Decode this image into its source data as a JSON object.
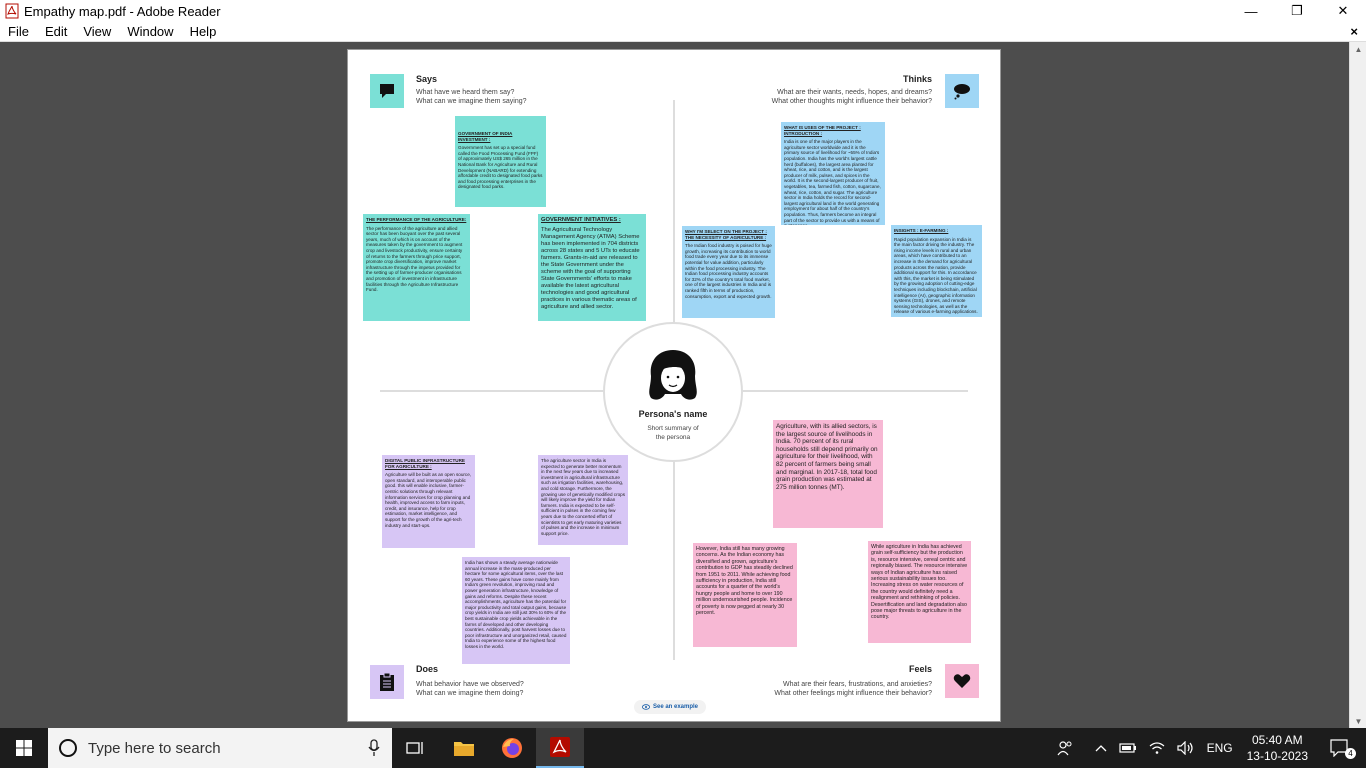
{
  "window": {
    "title": "Empathy map.pdf - Adobe Reader",
    "minimize": "—",
    "maximize": "❐",
    "close": "✕"
  },
  "menu": {
    "items": [
      "File",
      "Edit",
      "View",
      "Window",
      "Help"
    ],
    "close": "×"
  },
  "map": {
    "says": {
      "title": "Says",
      "line1": "What have we heard them say?",
      "line2": "What can we imagine them saying?"
    },
    "thinks": {
      "title": "Thinks",
      "line1": "What are their wants, needs, hopes, and dreams?",
      "line2": "What other thoughts might influence their behavior?"
    },
    "does": {
      "title": "Does",
      "line1": "What behavior have we observed?",
      "line2": "What can we imagine them doing?"
    },
    "feels": {
      "title": "Feels",
      "line1": "What are their fears, frustrations, and anxieties?",
      "line2": "What other feelings might influence their behavior?"
    },
    "persona": {
      "name": "Persona's name",
      "summary_line1": "Short summary of",
      "summary_line2": "the persona"
    },
    "see_example": "See an example",
    "notes": {
      "says_1_heading": "GOVERNMENT OF INDIA INVESTMENT :",
      "says_1_body": "Government has set up a special fund called the Food Processing Fund (FPF) of approximately US$ 265 million in the National Bank for Agriculture and Rural Development (NABARD) for extending affordable credit to designated food parks and food processing enterprises in the designated food parks.",
      "says_2_heading": "THE PERFORMANCE OF THE AGRICULTURE:",
      "says_2_body": "The performance of the agriculture and allied sector has been buoyant over the past several years, much of which is on account of the measures taken by the government to augment crop and livestock productivity, ensure certainty of returns to the farmers through price support, promote crop diversification, improve market infrastructure through the impetus provided for the setting up of farmer-producer organisations and promotion of investment in infrastructure facilities through the Agriculture Infrastructure Fund.",
      "says_3_heading": "GOVERNMENT INITIATIVES :",
      "says_3_body": "The Agricultural Technology Management Agency (ATMA) Scheme has been implemented in 704 districts across 28 states and 5 UTs to educate farmers. Grants-in-aid are released to the State Government under the scheme with the goal of supporting State Governments' efforts to make available the latest agricultural technologies and good agricultural practices in various thematic areas of agriculture and allied sector.",
      "thinks_1_heading": "WHAT IS USES OF THE PROJECT : INTRODUCTION :",
      "thinks_1_body": "India is one of the major players in the agriculture sector worldwide and it is the primary source of livelihood for ~55% of India's population. India has the world's largest cattle herd (buffaloes), the largest area planted for wheat, rice, and cotton, and is the largest producer of milk, pulses, and spices in the world. It is the second-largest producer of fruit, vegetables, tea, farmed fish, cotton, sugarcane, wheat, rice, cotton, and sugar. The agriculture sector in India holds the record for second-largest agricultural land in the world generating employment for about half of the country's population. Thus, farmers become an integral part of the sector to provide us with a means of sustenance.",
      "thinks_2_heading": "WHY I'M SELECT ON THE PROJECT : THE NECESSITY OF AGRICULTURE :",
      "thinks_2_body": "The Indian food industry is poised for huge growth, increasing its contribution to world food trade every year due to its immense potential for value addition, particularly within the food processing industry. The Indian food processing industry accounts for 32% of the country's total food market, one of the largest industries in India and is ranked fifth in terms of production, consumption, export and expected growth.",
      "thinks_3_heading": "INSIGHTS : E-FARMING :",
      "thinks_3_body": "Rapid population expansion in India is the main factor driving the industry. The rising income levels in rural and urban areas, which have contributed to an increase in the demand for agricultural products across the nation, provide additional support for this. In accordance with this, the market is being stimulated by the growing adoption of cutting-edge techniques including blockchain, artificial intelligence (AI), geographic information systems (GIS), drones, and remote sensing technologies, as well as the release of various e-farming applications.",
      "does_1_heading": "DIGITAL PUBLIC INFRASTRUCTURE FOR AGRICULTURE :",
      "does_1_body": "Agriculture will be built as an open source, open standard, and interoperable public good. this will enable inclusive, farmer-centric solutions through relevant information services for crop planning and health, improved access to farm inputs, credit, and insurance, help for crop estimation, market intelligence, and support for the growth of the agri-tech industry and start-ups.",
      "does_2_body": "The agriculture sector in India is expected to generate better momentum in the next few years due to increased investment in agricultural infrastructure such as irrigation facilities, warehousing, and cold storage. Furthermore, the growing use of genetically modified crops will likely improve the yield for Indian farmers. India is expected to be self-sufficient in pulses in the coming few years due to the concerted effort of scientists to get early maturing varieties of pulses and the increase in minimum support price.",
      "does_3_body": "India has shown a steady average nationwide annual increase in the mass-produced per hectare for some agricultural items, over the last 60 years. These gains have come mainly from India's green revolution, improving road and power generation infrastructure, knowledge of gains and reforms. Despite these recent accomplishments, agriculture has the potential for major productivity and total output gains, because crop yields in India are still just 30% to 60% of the best sustainable crop yields achievable in the farms of developed and other developing countries. Additionally, post harvest losses due to poor infrastructure and unorganized retail, caused India to experience some of the highest food losses in the world.",
      "feels_1_body": "Agriculture, with its allied sectors, is the largest source of livelihoods in India. 70 percent of its rural households still depend primarily on agriculture for their livelihood, with 82 percent of farmers being small and marginal. In 2017-18, total food grain production was estimated at 275 million tonnes (MT).",
      "feels_2_body": "However, India still has many growing concerns. As the Indian economy has diversified and grown, agriculture's contribution to GDP has steadily declined from 1951 to 2011. While achieving food sufficiency in production, India still accounts for a quarter of the world's hungry people and home to over 190 million undernourished people. Incidence of poverty is now pegged at nearly 30 percent.",
      "feels_3_body": "While agriculture in India has achieved grain self-sufficiency but the production is, resource intensive, cereal centric and regionally biased. The resource intensive ways of Indian agriculture has raised serious sustainability issues too. Increasing stress on water resources of the country would definitely need a realignment and rethinking of policies. Desertification and land degradation also pose major threats to agriculture in the country."
    }
  },
  "taskbar": {
    "search_placeholder": "Type here to search",
    "language": "ENG",
    "time": "05:40 AM",
    "date": "13-10-2023",
    "notification_count": "4"
  },
  "colors": {
    "teal": "#7be0d6",
    "blue": "#9fd6f5",
    "purple": "#d7c6f5",
    "pink": "#f7b8d4"
  }
}
